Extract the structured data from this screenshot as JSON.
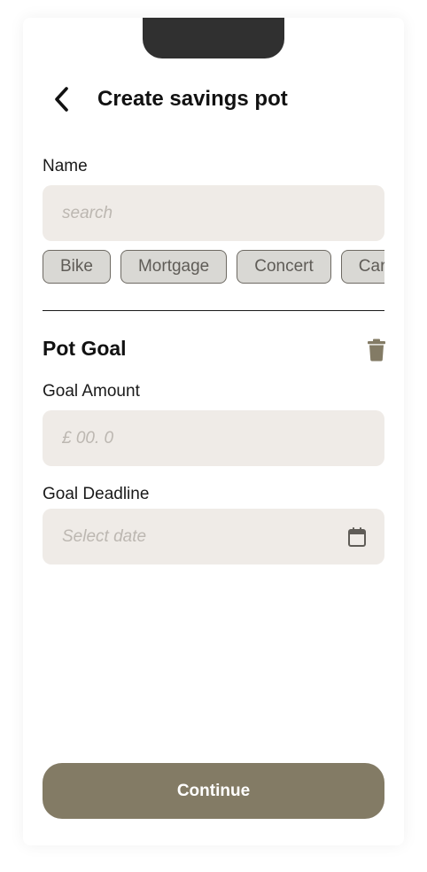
{
  "header": {
    "title": "Create savings pot",
    "back_icon": "chevron-left-icon"
  },
  "name_section": {
    "label": "Name",
    "input_placeholder": "search",
    "input_value": "",
    "suggestions": [
      {
        "label": "Bike"
      },
      {
        "label": "Mortgage"
      },
      {
        "label": "Concert"
      },
      {
        "label": "Car"
      }
    ]
  },
  "pot_goal": {
    "title": "Pot Goal",
    "delete_icon": "trash-icon",
    "amount_label": "Goal Amount",
    "amount_placeholder": "£ 00. 0",
    "amount_value": "",
    "deadline_label": "Goal Deadline",
    "deadline_placeholder": "Select date",
    "deadline_value": "",
    "calendar_icon": "calendar-icon"
  },
  "footer": {
    "continue_label": "Continue"
  },
  "colors": {
    "accent": "#837b65",
    "field_bg": "#efebe7",
    "chip_bg": "#d9d8d4",
    "notch": "#303030"
  }
}
